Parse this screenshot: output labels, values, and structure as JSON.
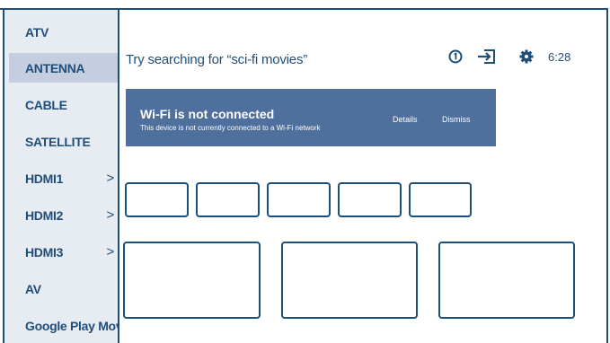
{
  "sidebar": {
    "items": [
      {
        "label": "ATV",
        "chevron": ""
      },
      {
        "label": "ANTENNA",
        "chevron": ""
      },
      {
        "label": "CABLE",
        "chevron": ""
      },
      {
        "label": "SATELLITE",
        "chevron": ""
      },
      {
        "label": "HDMI1",
        "chevron": ">"
      },
      {
        "label": "HDMI2",
        "chevron": ">"
      },
      {
        "label": "HDMI3",
        "chevron": ">"
      },
      {
        "label": "AV",
        "chevron": ""
      },
      {
        "label": "Google Play Movies",
        "chevron": ""
      }
    ],
    "selected": "ANTENNA"
  },
  "search": {
    "text": "Try searching for “sci-fi movies”"
  },
  "status": {
    "notification_icon": "info-circle-icon",
    "input_icon": "input-source-icon",
    "settings_icon": "gear-icon",
    "time": "6:28"
  },
  "banner": {
    "title": "Wi-Fi is not connected",
    "subtitle": "This device is not currently connected to a Wi-Fi network",
    "details": "Details",
    "dismiss": "Dismiss"
  },
  "colors": {
    "primary": "#1f4e79",
    "banner_bg": "#4f6f9c",
    "sidebar_bg": "#e7ebf2",
    "selected_bg": "#c5cde0"
  }
}
